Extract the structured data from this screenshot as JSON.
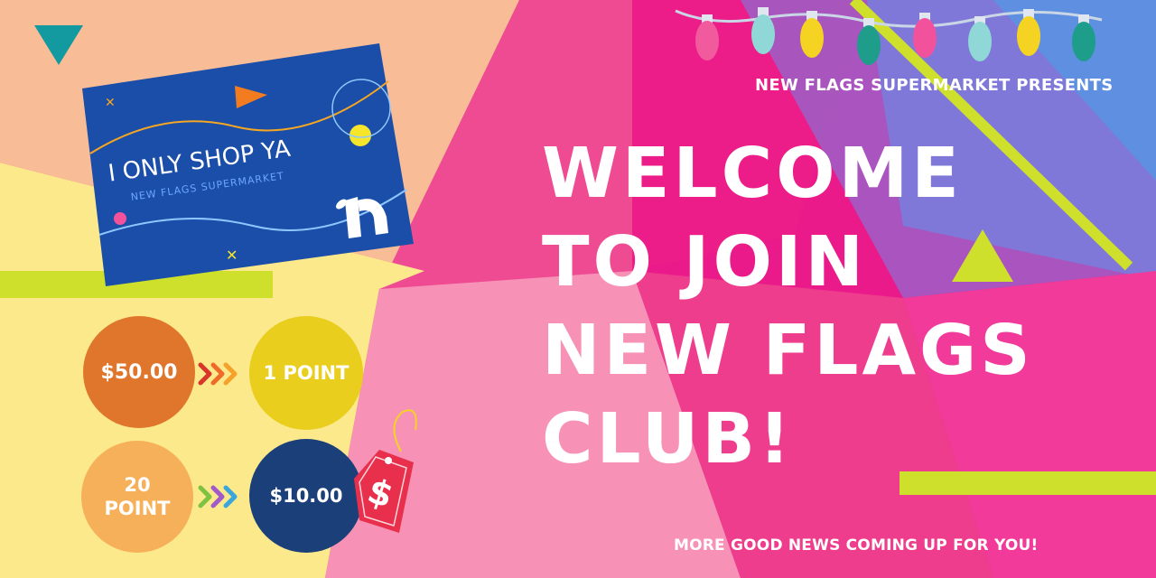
{
  "presents_text": "NEW FLAGS SUPERMARKET PRESENTS",
  "headline_lines": [
    "WELCOME",
    "TO JOIN",
    "NEW FLAGS",
    "CLUB!"
  ],
  "footer_text": "MORE GOOD NEWS COMING UP FOR YOU!",
  "card": {
    "title": "I ONLY SHOP YA",
    "subtitle": "NEW FLAGS SUPERMARKET"
  },
  "rewards": {
    "spend_amount": "$50.00",
    "earn_points": "1 POINT",
    "redeem_points_line1": "20",
    "redeem_points_line2": "POINT",
    "redeem_value": "$10.00",
    "tag_symbol": "$"
  },
  "colors": {
    "peach": "#f8bd96",
    "hot_pink": "#ee3d8c",
    "magenta": "#ea1a8a",
    "yellow_bg": "#fce98c",
    "light_pink": "#f792b6",
    "lime": "#cfe02c",
    "teal": "#129aa0",
    "card_blue": "#1a4ea8"
  },
  "icons": [
    "string-lights-icon",
    "price-tag-icon",
    "brand-logo-icon",
    "chevron-arrows-icon"
  ]
}
